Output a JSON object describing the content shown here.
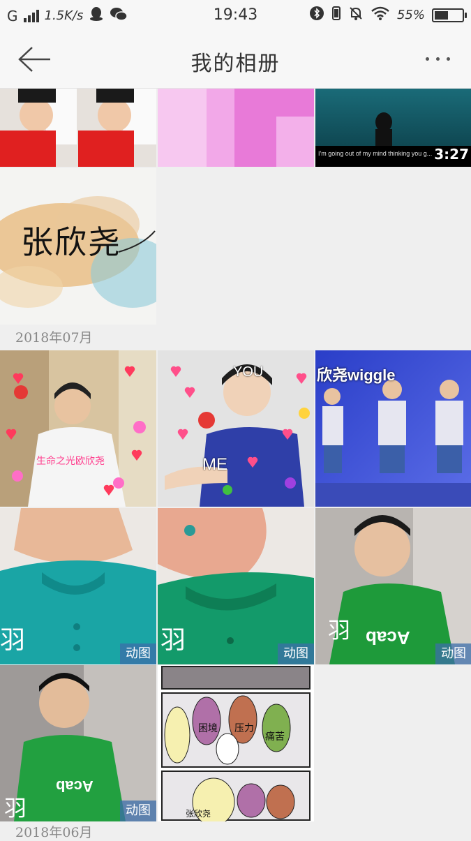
{
  "status_bar": {
    "network": "G",
    "speed": "1.5K/s",
    "time": "19:43",
    "battery": "55%",
    "battery_level": 0.55
  },
  "header": {
    "title": "我的相册"
  },
  "sections": [
    {
      "date": "2018年07月"
    },
    {
      "date": "2018年06月"
    }
  ],
  "photos": {
    "video_duration": "3:27",
    "video_caption": "I'm going out of my mind thinking you g...",
    "calligraphy": "张欣尧",
    "heart_meme_caption": "生命之光欧欣尧",
    "you_label": "YOU",
    "me_label": "ME",
    "wiggle_label": "欣尧wiggle",
    "gif_badge": "动图",
    "shirt_text": "Acab",
    "yu_char": "羽",
    "comic_labels": [
      "困境",
      "压力",
      "痛苦"
    ],
    "comic_name": "张欣尧"
  },
  "colors": {
    "accent_badge": "#3c6eaa",
    "background": "#efefef",
    "header_bg": "#f7f7f7"
  }
}
